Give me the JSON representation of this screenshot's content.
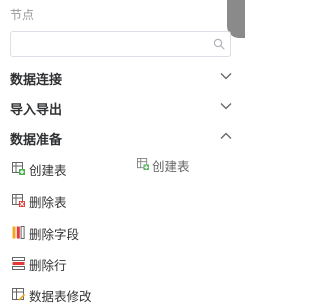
{
  "panel": {
    "title": "节点",
    "search": {
      "value": "",
      "placeholder": ""
    }
  },
  "sections": [
    {
      "label": "数据连接",
      "expanded": false,
      "chevron_icon": "chevron-down-icon"
    },
    {
      "label": "导入导出",
      "expanded": false,
      "chevron_icon": "chevron-down-icon"
    },
    {
      "label": "数据准备",
      "expanded": true,
      "chevron_icon": "chevron-up-icon"
    }
  ],
  "items": [
    {
      "label": "创建表",
      "icon": "create-table-icon"
    },
    {
      "label": "删除表",
      "icon": "delete-table-icon"
    },
    {
      "label": "删除字段",
      "icon": "delete-field-icon"
    },
    {
      "label": "删除行",
      "icon": "delete-row-icon"
    },
    {
      "label": "数据表修改",
      "icon": "modify-table-icon"
    }
  ],
  "drag_ghost": {
    "label": "创建表",
    "icon": "create-table-icon"
  },
  "colors": {
    "accent_green": "#4caf50",
    "accent_red": "#e53935",
    "accent_orange": "#f5a623",
    "text": "#333333",
    "muted": "#999999"
  }
}
